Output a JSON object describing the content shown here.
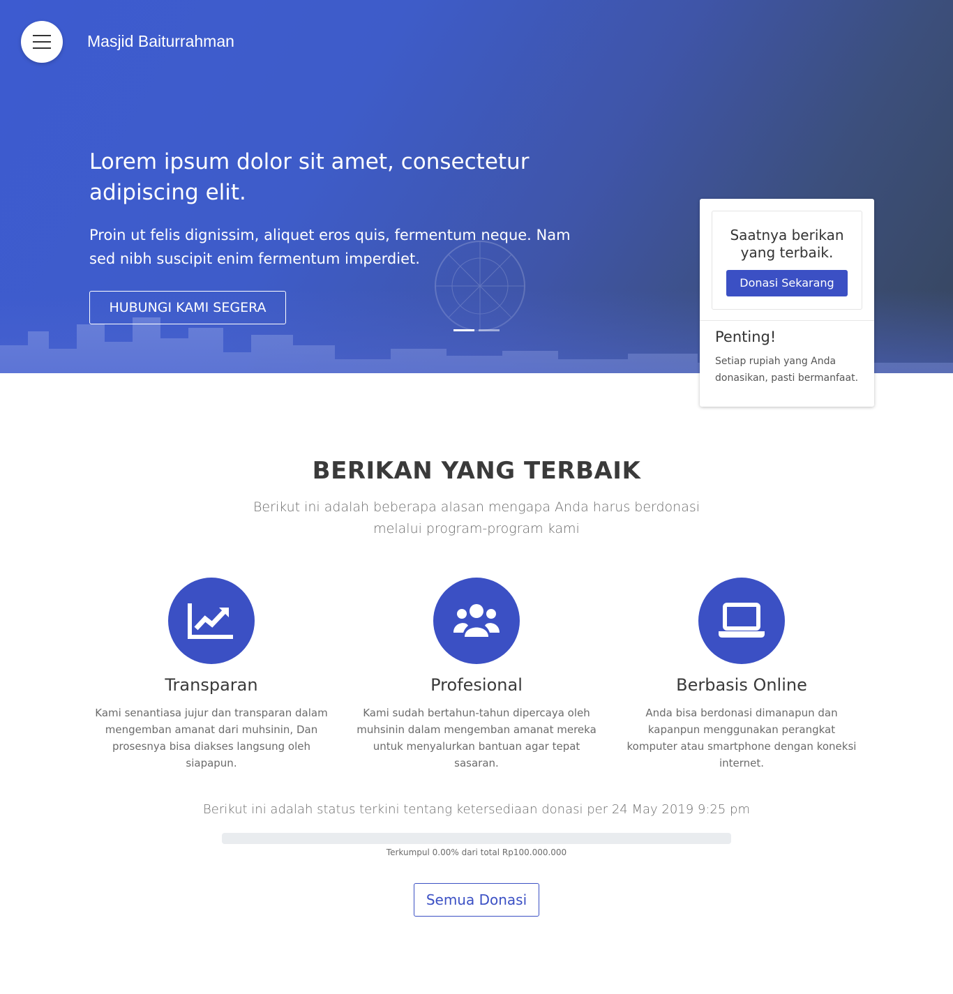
{
  "header": {
    "brand": "Masjid Baiturrahman",
    "menu_icon": "hamburger-menu-icon"
  },
  "hero": {
    "title": "Lorem ipsum dolor sit amet, consectetur adipiscing elit.",
    "subtitle": "Proin ut felis dignissim, aliquet eros quis, fermentum neque. Nam sed nibh suscipit enim fermentum imperdiet.",
    "cta_label": "HUBUNGI KAMI SEGERA",
    "slide_count": 2,
    "active_slide": 1
  },
  "donation_card": {
    "question": "Saatnya berikan yang terbaik.",
    "button_label": "Donasi Sekarang",
    "heading": "Penting!",
    "text": "Setiap rupiah yang Anda donasikan, pasti bermanfaat."
  },
  "section": {
    "title": "BERIKAN YANG TERBAIK",
    "subtitle": "Berikut ini adalah beberapa alasan mengapa Anda harus berdonasi melalui program-program kami"
  },
  "features": [
    {
      "icon": "chart-line-icon",
      "title": "Transparan",
      "text": "Kami senantiasa jujur dan transparan dalam mengemban amanat dari muhsinin, Dan prosesnya bisa diakses langsung oleh siapapun."
    },
    {
      "icon": "users-icon",
      "title": "Profesional",
      "text": "Kami sudah bertahun-tahun dipercaya oleh muhsinin dalam mengemban amanat mereka untuk menyalurkan bantuan agar tepat sasaran."
    },
    {
      "icon": "laptop-icon",
      "title": "Berbasis Online",
      "text": "Anda bisa berdonasi dimanapun dan kapanpun menggunakan perangkat komputer atau smartphone dengan koneksi internet."
    }
  ],
  "status": {
    "text": "Berikut ini adalah status terkini tentang ketersediaan donasi per 24 May 2019 9:25 pm",
    "progress_percent": 0,
    "caption": "Terkumpul 0.00% dari total Rp100.000.000"
  },
  "all_donations_label": "Semua Donasi",
  "colors": {
    "primary": "#3b50c4",
    "hero_start": "#3d5bd0",
    "hero_end": "#37465e"
  }
}
